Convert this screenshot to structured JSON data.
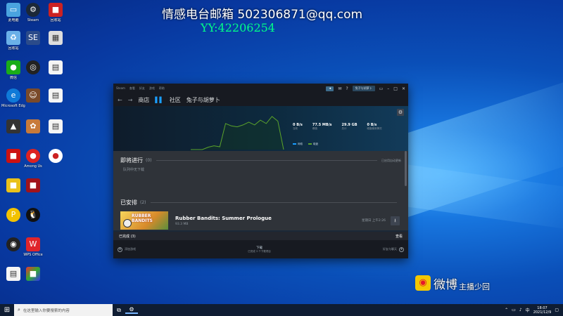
{
  "overlay": {
    "email": "情感电台邮箱 502306871@qq.com",
    "yy": "YY:42206254"
  },
  "desktop_icons": [
    "此电脑",
    "Steam",
    "回收站",
    "回收站",
    "SE",
    "",
    "微信",
    "",
    "",
    "Microsoft Edge",
    "",
    "",
    "",
    "",
    "",
    "",
    "Among Us",
    "",
    "",
    "",
    "",
    "",
    "",
    "",
    "",
    "WPS Office",
    "",
    "",
    "",
    ""
  ],
  "steam": {
    "menu": [
      "Steam",
      "查看",
      "好友",
      "游戏",
      "帮助"
    ],
    "account": "兔子与胡萝卜",
    "nav": {
      "store": "商店",
      "community": "社区",
      "user": "兔子与胡萝卜"
    },
    "stats": [
      {
        "value": "0 B/s",
        "label": "当前"
      },
      {
        "value": "77.5 MB/s",
        "label": "峰值"
      },
      {
        "value": "29.9 GB",
        "label": "总计"
      },
      {
        "value": "0 B/s",
        "label": "磁盘使用情况"
      }
    ],
    "legend": {
      "network": "网络",
      "disk": "磁盘"
    },
    "upcoming": {
      "title": "即将进行",
      "count": "(0)",
      "action": "已启用自动更新",
      "empty": "队列中无下载"
    },
    "scheduled": {
      "title": "已安排",
      "count": "(2)"
    },
    "item": {
      "thumb_text": "RUBBER BANDITS",
      "name": "Rubber Bandits: Summer Prologue",
      "size": "93.3 MB",
      "time": "星期日 上午2:26"
    },
    "completed": {
      "label": "已完成 (3)",
      "action": "查看"
    },
    "footer": {
      "add_game": "添加游戏",
      "download_title": "下载",
      "download_sub": "已完成 3 个下载项目",
      "friends": "好友与聊天"
    }
  },
  "chart_data": {
    "type": "line",
    "series": [
      {
        "name": "网络",
        "values": [
          0,
          0,
          0,
          5,
          8,
          6,
          55,
          50,
          48,
          52,
          58,
          52,
          62,
          55,
          70,
          60,
          0
        ]
      }
    ]
  },
  "weibo": {
    "brand": "微博",
    "handle": "主播少回"
  },
  "taskbar": {
    "search_placeholder": "在这里输入你要搜索的内容",
    "time": "18:07",
    "date": "2021/12/9"
  }
}
